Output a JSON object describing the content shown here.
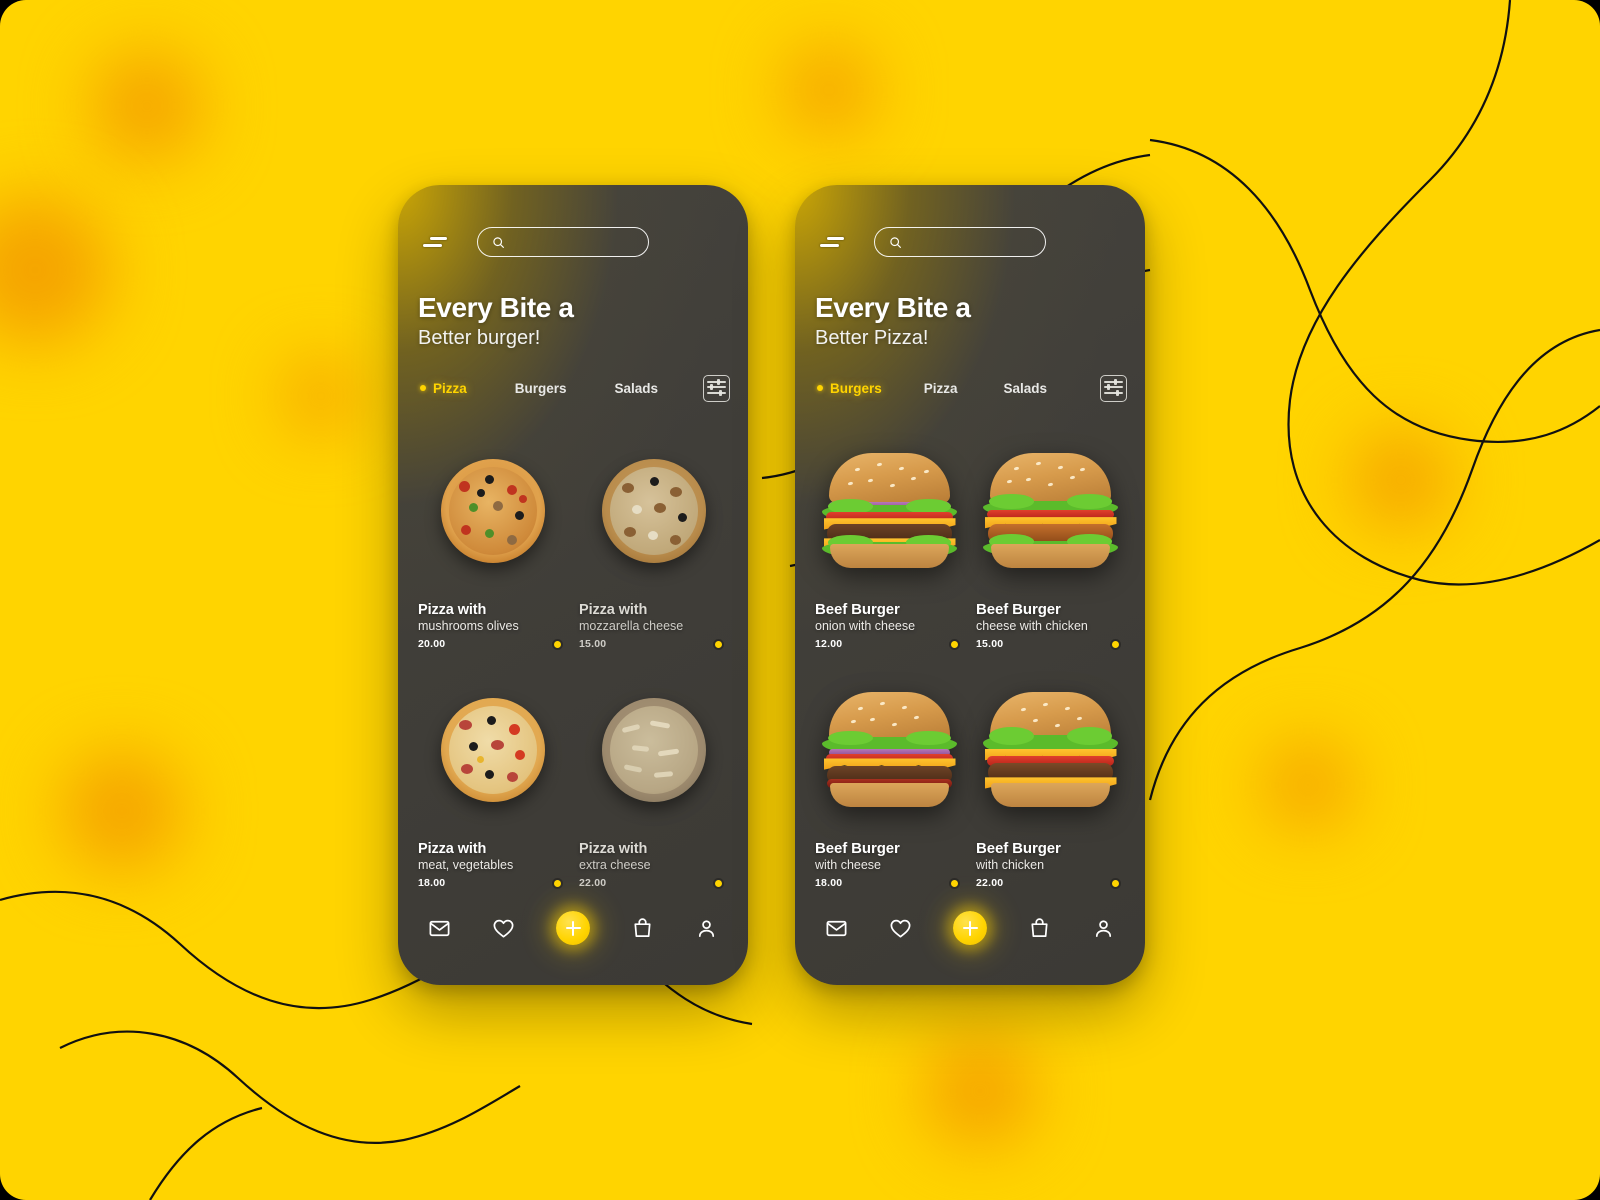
{
  "background": {
    "base_color": "#FFD400",
    "blob_color": "#F5A300",
    "line_color": "#111111"
  },
  "accent_color": "#FFD400",
  "screens": [
    {
      "id": "pizza-screen",
      "menu_icon": "hamburger-menu-icon",
      "search": {
        "value": "",
        "placeholder": ""
      },
      "headline": {
        "line1": "Every Bite a",
        "line2": "Better burger!"
      },
      "tabs": [
        {
          "label": "Pizza",
          "active": true
        },
        {
          "label": "Burgers",
          "active": false
        },
        {
          "label": "Salads",
          "active": false
        }
      ],
      "filter_icon": "filter-sliders-icon",
      "products": [
        {
          "title": "Pizza with",
          "subtitle": "mushrooms olives",
          "price": "20.00",
          "dim": false,
          "kind": "pizza",
          "variant": "supreme"
        },
        {
          "title": "Pizza with",
          "subtitle": "mozzarella cheese",
          "price": "15.00",
          "dim": true,
          "kind": "pizza",
          "variant": "mozzarella"
        },
        {
          "title": "Pizza with",
          "subtitle": "meat, vegetables",
          "price": "18.00",
          "dim": false,
          "kind": "pizza",
          "variant": "meatveg"
        },
        {
          "title": "Pizza with",
          "subtitle": "extra cheese",
          "price": "22.00",
          "dim": true,
          "kind": "pizza",
          "variant": "extracheese"
        }
      ],
      "nav": [
        {
          "icon": "mail-icon"
        },
        {
          "icon": "heart-icon"
        },
        {
          "icon": "plus-add-icon"
        },
        {
          "icon": "shopping-bag-icon"
        },
        {
          "icon": "person-account-icon"
        }
      ]
    },
    {
      "id": "burger-screen",
      "menu_icon": "hamburger-menu-icon",
      "search": {
        "value": "",
        "placeholder": ""
      },
      "headline": {
        "line1": "Every Bite a",
        "line2": "Better Pizza!"
      },
      "tabs": [
        {
          "label": "Burgers",
          "active": true
        },
        {
          "label": "Pizza",
          "active": false
        },
        {
          "label": "Salads",
          "active": false
        }
      ],
      "filter_icon": "filter-sliders-icon",
      "products": [
        {
          "title": "Beef Burger",
          "subtitle": "onion with cheese",
          "price": "12.00",
          "dim": false,
          "kind": "burger",
          "variant": "double"
        },
        {
          "title": "Beef Burger",
          "subtitle": "cheese with chicken",
          "price": "15.00",
          "dim": false,
          "kind": "burger",
          "variant": "chicken"
        },
        {
          "title": "Beef Burger",
          "subtitle": "with cheese",
          "price": "18.00",
          "dim": false,
          "kind": "burger",
          "variant": "bacon"
        },
        {
          "title": "Beef Burger",
          "subtitle": "with chicken",
          "price": "22.00",
          "dim": false,
          "kind": "burger",
          "variant": "lettuce"
        }
      ],
      "nav": [
        {
          "icon": "mail-icon"
        },
        {
          "icon": "heart-icon"
        },
        {
          "icon": "plus-add-icon"
        },
        {
          "icon": "shopping-bag-icon"
        },
        {
          "icon": "person-account-icon"
        }
      ]
    }
  ]
}
